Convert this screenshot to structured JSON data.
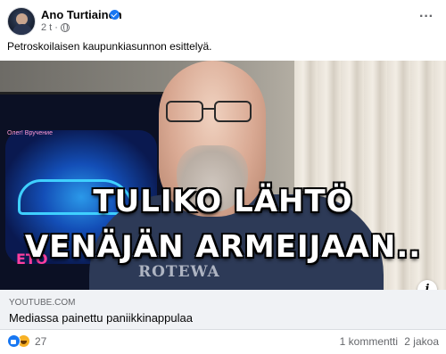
{
  "post": {
    "author": "Ano Turtiainen",
    "time": "2 t",
    "separator": "·",
    "text": "Petroskoilaisen kaupunkiasunnon esittelyä.",
    "more_label": "···"
  },
  "preview": {
    "overlay_line1": "TULIKO LÄHTÖ",
    "overlay_line2": "VENÄJÄN ARMEIJAAN..",
    "shirt_print": "ROTEWA",
    "tv_text": "Олег! Вручение",
    "tv_neon": "ЕТО",
    "info_label": "i",
    "domain": "YOUTUBE.COM",
    "title": "Mediassa painettu paniikkinappulaa"
  },
  "stats": {
    "reactions": "27",
    "comments": "1 kommentti",
    "shares": "2 jakoa"
  },
  "colors": {
    "accent": "#1877f2",
    "footer_bg": "#f0f2f5",
    "muted_text": "#65676b"
  },
  "icons": {
    "verified": "verified-badge-icon",
    "audience": "globe-icon",
    "like": "like-icon",
    "haha": "haha-icon",
    "info": "info-icon"
  }
}
